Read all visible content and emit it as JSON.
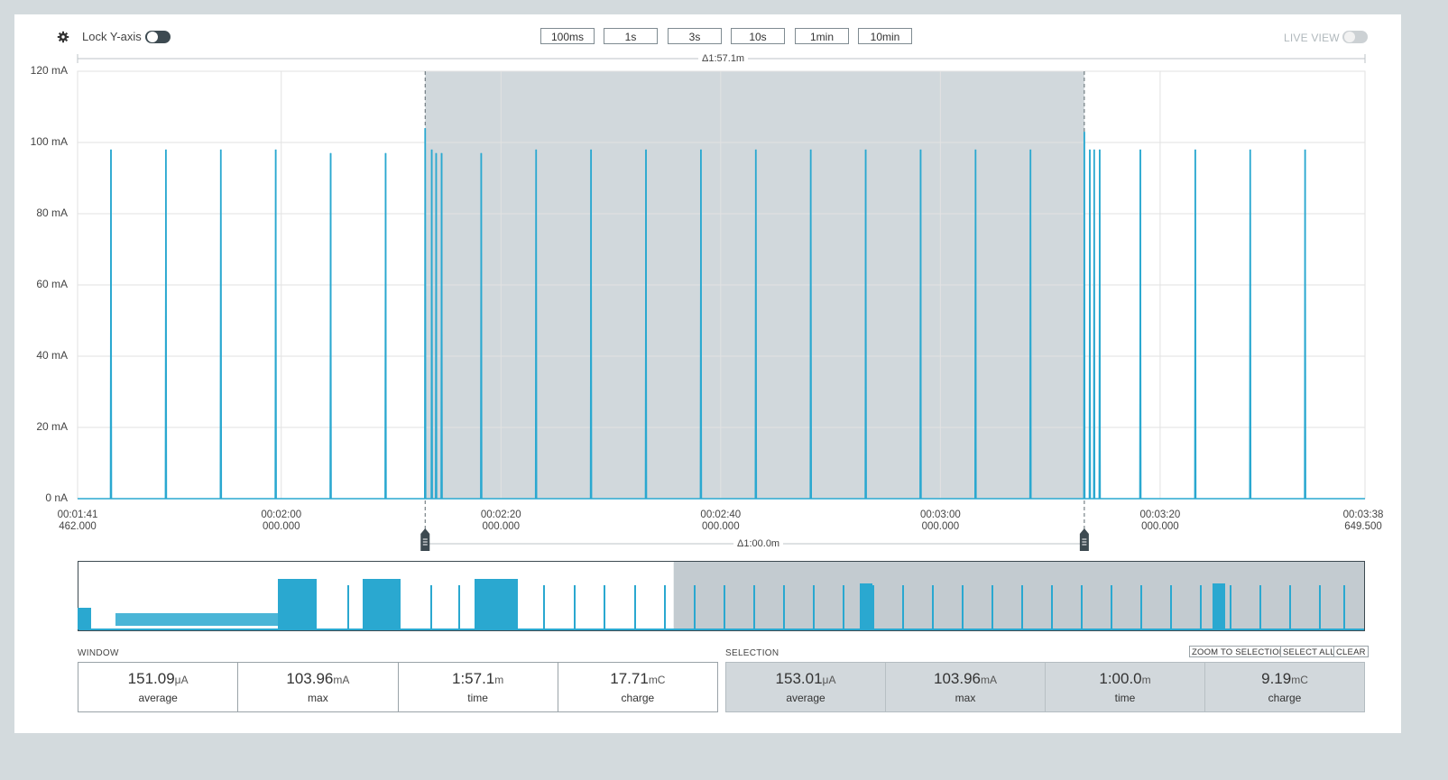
{
  "toolbar": {
    "lock_y_axis_label": "Lock Y-axis",
    "live_view_label": "LIVE VIEW",
    "window_buttons": [
      "100ms",
      "1s",
      "3s",
      "10s",
      "1min",
      "10min"
    ]
  },
  "chart_data": {
    "type": "line",
    "y_axis": {
      "ticks": [
        "120 mA",
        "100 mA",
        "80 mA",
        "60 mA",
        "40 mA",
        "20 mA",
        "0 nA"
      ],
      "ylim": [
        0,
        120
      ],
      "unit": "mA"
    },
    "x_axis": {
      "tick_labels": [
        {
          "time": "00:01:41",
          "ms": "462.000"
        },
        {
          "time": "00:02:00",
          "ms": "000.000"
        },
        {
          "time": "00:02:20",
          "ms": "000.000"
        },
        {
          "time": "00:02:40",
          "ms": "000.000"
        },
        {
          "time": "00:03:00",
          "ms": "000.000"
        },
        {
          "time": "00:03:20",
          "ms": "000.000"
        },
        {
          "time": "00:03:38",
          "ms": "649.500"
        }
      ],
      "range_seconds": [
        101.462,
        218.6495
      ],
      "tick_seconds": [
        101.462,
        120,
        140,
        160,
        180,
        200,
        218.6495
      ]
    },
    "window_delta": "Δ1:57.1m",
    "selection_delta": "Δ1:00.0m",
    "selection_range_seconds": [
      133.1,
      193.1
    ],
    "series": [
      {
        "color": "#2aa8d0",
        "spikes_seconds": [
          104.5,
          109.5,
          114.5,
          119.5,
          124.5,
          129.5,
          133.1,
          133.7,
          134.1,
          134.6,
          138.2,
          143.2,
          148.2,
          153.2,
          158.2,
          163.2,
          168.2,
          173.2,
          178.2,
          183.2,
          188.2,
          193.1,
          193.6,
          194.0,
          194.5,
          198.2,
          203.2,
          208.2,
          213.2
        ],
        "spikes_mA": [
          98,
          98,
          98,
          98,
          97,
          97,
          104,
          98,
          97,
          97,
          97,
          98,
          98,
          98,
          98,
          98,
          98,
          98,
          98,
          98,
          98,
          103,
          98,
          98,
          98,
          98,
          98,
          98,
          98
        ]
      }
    ]
  },
  "overview": {
    "selection_fraction": [
      0.463,
      1.0
    ]
  },
  "window_stats": {
    "title": "WINDOW",
    "average": {
      "value": "151.09",
      "unit": "μA",
      "label": "average"
    },
    "max": {
      "value": "103.96",
      "unit": "mA",
      "label": "max"
    },
    "time": {
      "value": "1:57.1",
      "unit": "m",
      "label": "time"
    },
    "charge": {
      "value": "17.71",
      "unit": "mC",
      "label": "charge"
    }
  },
  "selection_stats": {
    "title": "SELECTION",
    "zoom_label": "ZOOM TO SELECTION",
    "select_all_label": "SELECT ALL",
    "clear_label": "CLEAR",
    "average": {
      "value": "153.01",
      "unit": "μA",
      "label": "average"
    },
    "max": {
      "value": "103.96",
      "unit": "mA",
      "label": "max"
    },
    "time": {
      "value": "1:00.0",
      "unit": "m",
      "label": "time"
    },
    "charge": {
      "value": "9.19",
      "unit": "mC",
      "label": "charge"
    }
  }
}
